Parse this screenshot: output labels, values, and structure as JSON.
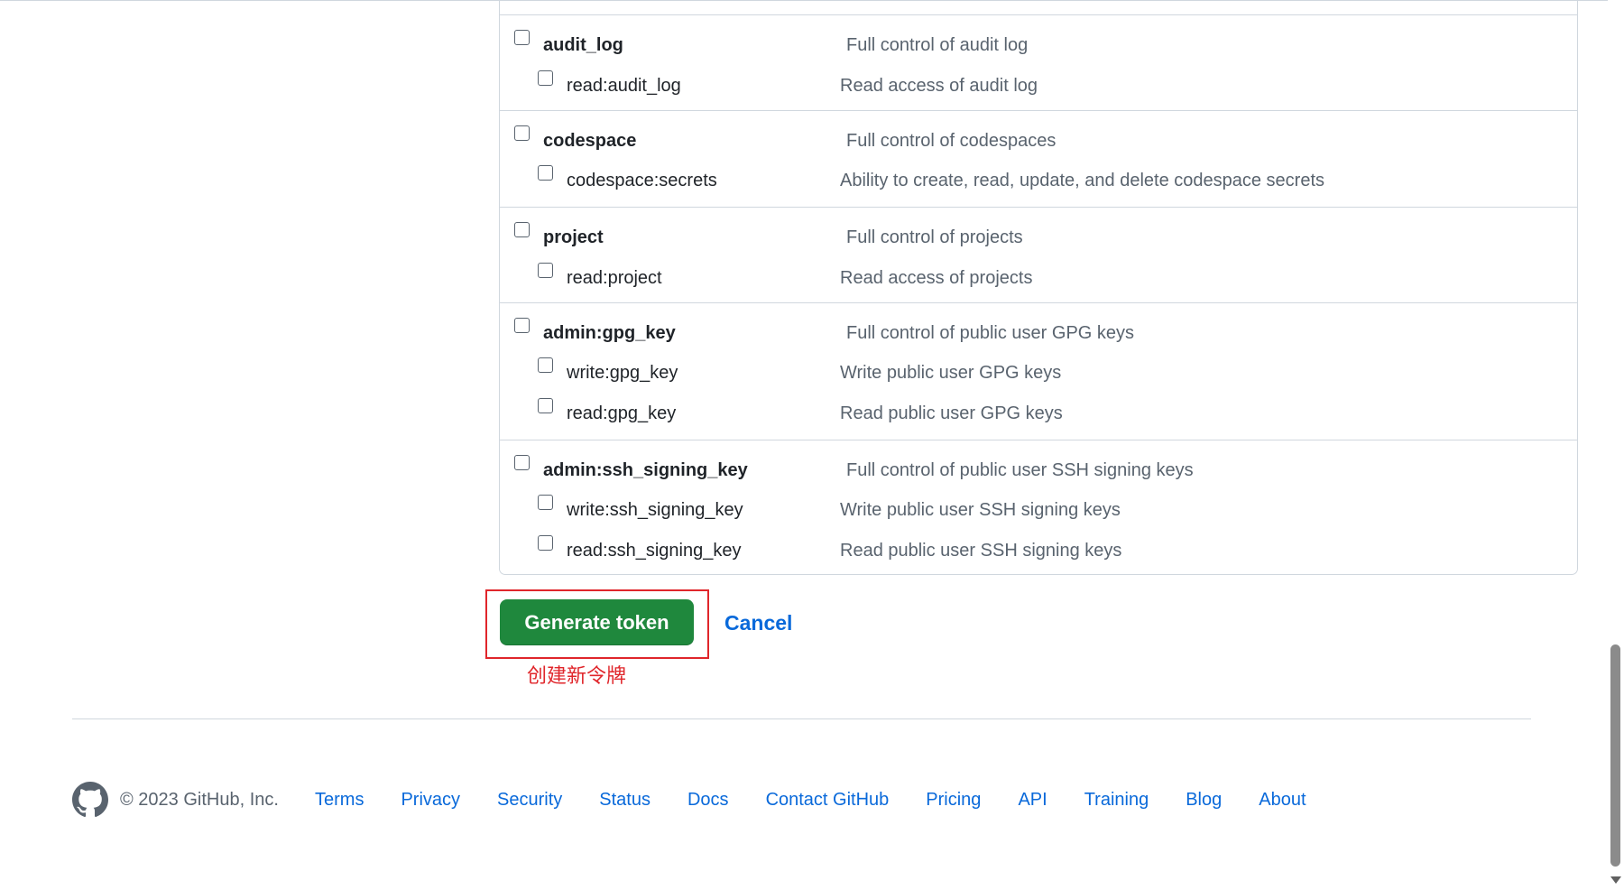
{
  "scope_groups": [
    {
      "parent": {
        "name": "audit_log",
        "description": "Full control of audit log"
      },
      "children": [
        {
          "name": "read:audit_log",
          "description": "Read access of audit log"
        }
      ]
    },
    {
      "parent": {
        "name": "codespace",
        "description": "Full control of codespaces"
      },
      "children": [
        {
          "name": "codespace:secrets",
          "description": "Ability to create, read, update, and delete codespace secrets"
        }
      ]
    },
    {
      "parent": {
        "name": "project",
        "description": "Full control of projects"
      },
      "children": [
        {
          "name": "read:project",
          "description": "Read access of projects"
        }
      ]
    },
    {
      "parent": {
        "name": "admin:gpg_key",
        "description": "Full control of public user GPG keys"
      },
      "children": [
        {
          "name": "write:gpg_key",
          "description": "Write public user GPG keys"
        },
        {
          "name": "read:gpg_key",
          "description": "Read public user GPG keys"
        }
      ]
    },
    {
      "parent": {
        "name": "admin:ssh_signing_key",
        "description": "Full control of public user SSH signing keys"
      },
      "children": [
        {
          "name": "write:ssh_signing_key",
          "description": "Write public user SSH signing keys"
        },
        {
          "name": "read:ssh_signing_key",
          "description": "Read public user SSH signing keys"
        }
      ]
    }
  ],
  "actions": {
    "generate_label": "Generate token",
    "cancel_label": "Cancel"
  },
  "annotation": {
    "text": "创建新令牌",
    "color": "#e0262b"
  },
  "footer": {
    "logo_icon": "github-mark-icon",
    "copyright": "© 2023 GitHub, Inc.",
    "links": [
      "Terms",
      "Privacy",
      "Security",
      "Status",
      "Docs",
      "Contact GitHub",
      "Pricing",
      "API",
      "Training",
      "Blog",
      "About"
    ]
  },
  "colors": {
    "primary_button": "#1f883d",
    "link": "#0969da",
    "border": "#d0d7de",
    "muted_text": "#59636e"
  }
}
